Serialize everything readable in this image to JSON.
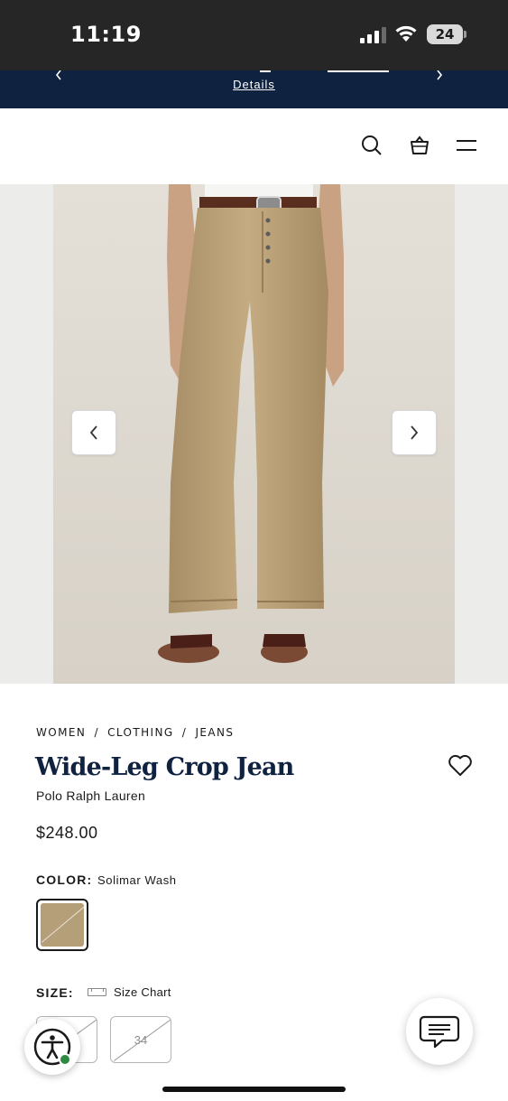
{
  "status_bar": {
    "time": "11:19",
    "battery": "24"
  },
  "promo": {
    "details_link": "Details"
  },
  "header": {
    "icons": [
      "search-icon",
      "shopping-bag-icon",
      "menu-icon"
    ]
  },
  "gallery": {
    "image": "model-wearing-khaki-wide-leg-jeans",
    "prev_icon": "chevron-left-icon",
    "next_icon": "chevron-right-icon"
  },
  "breadcrumb": {
    "items": [
      "WOMEN",
      "CLOTHING",
      "JEANS"
    ],
    "separator": "/"
  },
  "product": {
    "title": "Wide-Leg Crop Jean",
    "brand": "Polo Ralph Lauren",
    "price": "$248.00"
  },
  "color": {
    "label": "COLOR:",
    "value": "Solimar Wash",
    "swatch_hex": "#b59f78"
  },
  "size": {
    "label": "SIZE:",
    "chart_label": "Size Chart",
    "options": [
      "",
      "34"
    ]
  },
  "colors": {
    "promo_bg": "#0f2240",
    "title": "#0f2240",
    "status_bg": "#262626"
  }
}
